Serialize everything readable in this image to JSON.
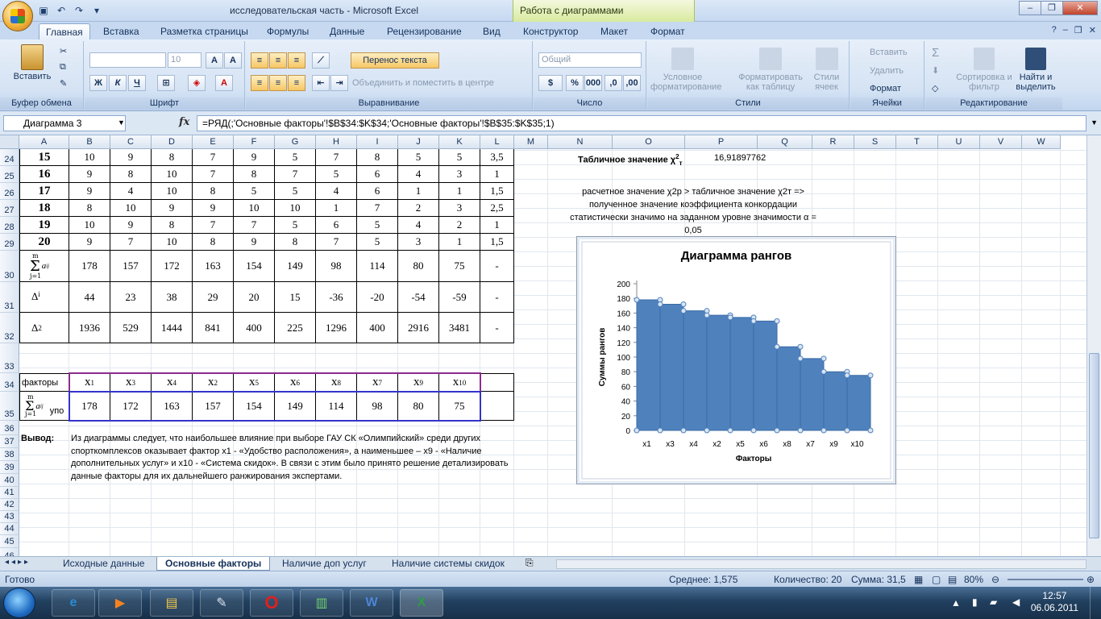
{
  "title": {
    "text": "исследовательская часть - Microsoft Excel",
    "context_tab": "Работа с диаграммами"
  },
  "tabs": [
    "Главная",
    "Вставка",
    "Разметка страницы",
    "Формулы",
    "Данные",
    "Рецензирование",
    "Вид",
    "Конструктор",
    "Макет",
    "Формат"
  ],
  "ribbon": {
    "paste": "Вставить",
    "clipboard": "Буфер обмена",
    "font_size": "10",
    "font": "Шрифт",
    "wrap_text": "Перенос текста",
    "merge_center": "Объединить и поместить в центре",
    "alignment": "Выравнивание",
    "number_format": "Общий",
    "number": "Число",
    "conditional": "Условное форматирование",
    "format_table": "Форматировать как таблицу",
    "cell_styles": "Стили ячеек",
    "styles": "Стили",
    "insert": "Вставить",
    "delete": "Удалить",
    "format": "Формат",
    "cells": "Ячейки",
    "sort_filter": "Сортировка и фильтр",
    "find_select": "Найти и выделить",
    "editing": "Редактирование"
  },
  "formula_bar": {
    "name_box": "Диаграмма 3",
    "fx": "fx",
    "formula": "=РЯД(;'Основные факторы'!$B$34:$K$34;'Основные факторы'!$B$35:$K$35;1)"
  },
  "columns": [
    "A",
    "B",
    "C",
    "D",
    "E",
    "F",
    "G",
    "H",
    "I",
    "J",
    "K",
    "L",
    "M",
    "N",
    "O",
    "P",
    "Q",
    "R",
    "S",
    "T",
    "U",
    "V",
    "W"
  ],
  "rows": [
    "24",
    "25",
    "26",
    "27",
    "28",
    "29",
    "30",
    "31",
    "32",
    "33",
    "34",
    "35",
    "36",
    "37",
    "38",
    "39",
    "40",
    "41",
    "42",
    "43",
    "44",
    "45",
    "46"
  ],
  "table": [
    {
      "id": "15",
      "vals": [
        "10",
        "9",
        "8",
        "7",
        "9",
        "5",
        "7",
        "8",
        "5",
        "5",
        "3,5"
      ]
    },
    {
      "id": "16",
      "vals": [
        "9",
        "8",
        "10",
        "7",
        "8",
        "7",
        "5",
        "6",
        "4",
        "3",
        "1"
      ]
    },
    {
      "id": "17",
      "vals": [
        "9",
        "4",
        "10",
        "8",
        "5",
        "5",
        "4",
        "6",
        "1",
        "1",
        "1,5"
      ]
    },
    {
      "id": "18",
      "vals": [
        "8",
        "10",
        "9",
        "9",
        "10",
        "10",
        "1",
        "7",
        "2",
        "3",
        "2,5"
      ]
    },
    {
      "id": "19",
      "vals": [
        "10",
        "9",
        "8",
        "7",
        "7",
        "5",
        "6",
        "5",
        "4",
        "2",
        "1"
      ]
    },
    {
      "id": "20",
      "vals": [
        "9",
        "7",
        "10",
        "8",
        "9",
        "8",
        "7",
        "5",
        "3",
        "1",
        "1,5"
      ]
    }
  ],
  "sum_row": [
    "178",
    "157",
    "172",
    "163",
    "154",
    "149",
    "98",
    "114",
    "80",
    "75",
    "-"
  ],
  "delta_label": "Δ",
  "delta_sub": "i",
  "delta_row": [
    "44",
    "23",
    "38",
    "29",
    "20",
    "15",
    "-36",
    "-20",
    "-54",
    "-59",
    "-"
  ],
  "delta2_label": "Δ",
  "delta2_sup": "2",
  "delta2_row": [
    "1936",
    "529",
    "1444",
    "841",
    "400",
    "225",
    "1296",
    "400",
    "2916",
    "3481",
    "-"
  ],
  "sum_symbol": {
    "top": "m",
    "bottom": "j=1",
    "var": "a",
    "sub": "ij"
  },
  "factors_label": "факторы",
  "factors": [
    {
      "x": "x",
      "sub": "1"
    },
    {
      "x": "x",
      "sub": "3"
    },
    {
      "x": "x",
      "sub": "4"
    },
    {
      "x": "x",
      "sub": "2"
    },
    {
      "x": "x",
      "sub": "5"
    },
    {
      "x": "x",
      "sub": "6"
    },
    {
      "x": "x",
      "sub": "8"
    },
    {
      "x": "x",
      "sub": "7"
    },
    {
      "x": "x",
      "sub": "9"
    },
    {
      "x": "x",
      "sub": "10"
    }
  ],
  "sorted_label_suffix": "упо",
  "sorted_sums": [
    "178",
    "172",
    "163",
    "157",
    "154",
    "149",
    "114",
    "98",
    "80",
    "75"
  ],
  "conclusion": {
    "label": "Вывод:",
    "lines": [
      "Из диаграммы следует, что  наибольшее влияние при выборе ГАУ СК «Олимпийский» среди других",
      "спорткомплексов оказывает фактор  x1 - «Удобство расположения», а наименьшее – x9 - «Наличие",
      "дополнительных услуг» и x10 - «Система скидок».  В связи с этим было принято решение детализировать",
      "данные факторы для их дальнейшего ранжирования экспертами."
    ]
  },
  "side": {
    "table_label": "Табличное значение χ",
    "table_label_sup": "2",
    "table_label_sub": "т",
    "table_value": "16,91897762",
    "text_lines": [
      "расчетное значение χ2р > табличное значение χ2т =>",
      "полученное значение коэффициента конкордации",
      "статистически значимо на заданном  уровне значимости  α =",
      "0,05"
    ]
  },
  "chart_data": {
    "type": "area",
    "title": "Диаграмма рангов",
    "xlabel": "Факторы",
    "ylabel": "Суммы рангов",
    "categories": [
      "x1",
      "x3",
      "x4",
      "x2",
      "x5",
      "x6",
      "x8",
      "x7",
      "x9",
      "x10"
    ],
    "values": [
      178,
      172,
      163,
      157,
      154,
      149,
      114,
      98,
      80,
      75
    ],
    "ylim": [
      0,
      200
    ],
    "yticks": [
      0,
      20,
      40,
      60,
      80,
      100,
      120,
      140,
      160,
      180,
      200
    ],
    "color": "#4f81bd"
  },
  "sheet_tabs": [
    "Исходные данные",
    "Основные факторы",
    "Наличие доп услуг",
    "Наличие системы скидок"
  ],
  "status": {
    "ready": "Готово",
    "average": "Среднее: 1,575",
    "count": "Количество: 20",
    "sum": "Сумма: 31,5",
    "zoom": "80%"
  },
  "taskbar": {
    "time": "12:57",
    "date": "06.06.2011"
  }
}
